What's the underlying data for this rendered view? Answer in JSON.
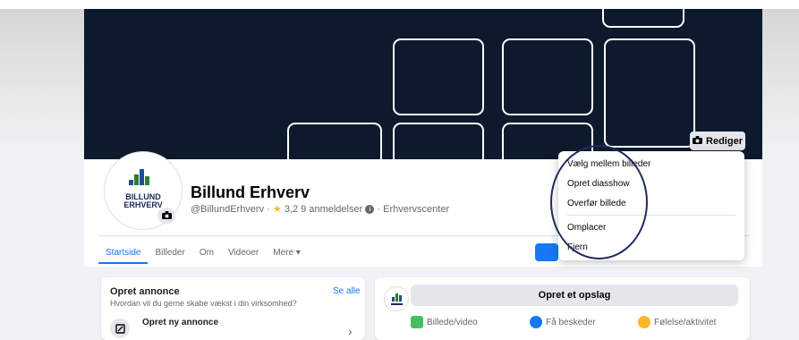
{
  "page": {
    "name": "Billund Erhverv",
    "handle": "@BillundErhverv",
    "rating_star": "★",
    "rating_text": "3,2 9 anmeldelser",
    "category": "Erhvervscenter",
    "logo_text_line1": "BILLUND",
    "logo_text_line2": "ERHVERV"
  },
  "cover": {
    "edit_label": "Rediger"
  },
  "tabs": [
    {
      "label": "Startside"
    },
    {
      "label": "Billeder"
    },
    {
      "label": "Om"
    },
    {
      "label": "Videoer"
    },
    {
      "label": "Mere ▾"
    }
  ],
  "dropdown": {
    "items": [
      {
        "label": "Vælg mellem billeder"
      },
      {
        "label": "Opret diasshow"
      },
      {
        "label": "Overfør billede"
      },
      {
        "label": "Omplacer"
      },
      {
        "label": "Fjern"
      }
    ]
  },
  "ad_card": {
    "title": "Opret annonce",
    "see_all": "Se alle",
    "subtitle": "Hvordan vil du gerne skabe vækst i din virksomhed?",
    "new_ad": "Opret ny annonce"
  },
  "post_card": {
    "create_label": "Opret et opslag",
    "actions": [
      {
        "label": "Billede/video",
        "color": "#45bd62"
      },
      {
        "label": "Få beskeder",
        "color": "#1877f2"
      },
      {
        "label": "Følelse/aktivitet",
        "color": "#f7b928"
      }
    ]
  },
  "colors": {
    "accent": "#1877f2",
    "cover_bg": "#0d1a2e",
    "highlight_circle": "#1f2a5c"
  }
}
